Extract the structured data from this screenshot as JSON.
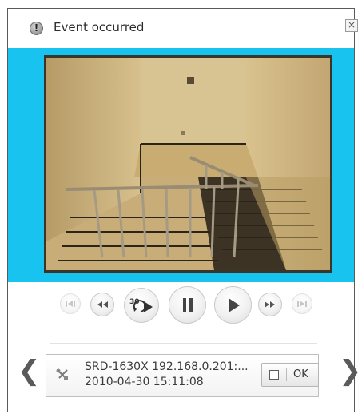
{
  "window": {
    "title": "Event occurred",
    "close_label": "×"
  },
  "icons": {
    "title_icon": "!"
  },
  "controls": [
    {
      "name": "prev-frame-button",
      "icon": "step-back-icon",
      "disabled": true
    },
    {
      "name": "rewind-button",
      "icon": "rewind-icon",
      "disabled": false
    },
    {
      "name": "replay-30-button",
      "icon": "replay-30-icon",
      "label": "30",
      "disabled": false
    },
    {
      "name": "pause-button",
      "icon": "pause-icon",
      "disabled": false
    },
    {
      "name": "play-button",
      "icon": "play-icon",
      "disabled": false
    },
    {
      "name": "fast-forward-button",
      "icon": "fast-forward-icon",
      "disabled": false
    },
    {
      "name": "next-frame-button",
      "icon": "step-forward-icon",
      "disabled": true
    }
  ],
  "event": {
    "line1": "SRD-1630X  192.168.0.201:...",
    "line2": "2010-04-30 15:11:08",
    "ok_label": "OK"
  },
  "nav": {
    "prev": "❮",
    "next": "❯"
  },
  "colors": {
    "video_bg": "#19c3f0"
  }
}
